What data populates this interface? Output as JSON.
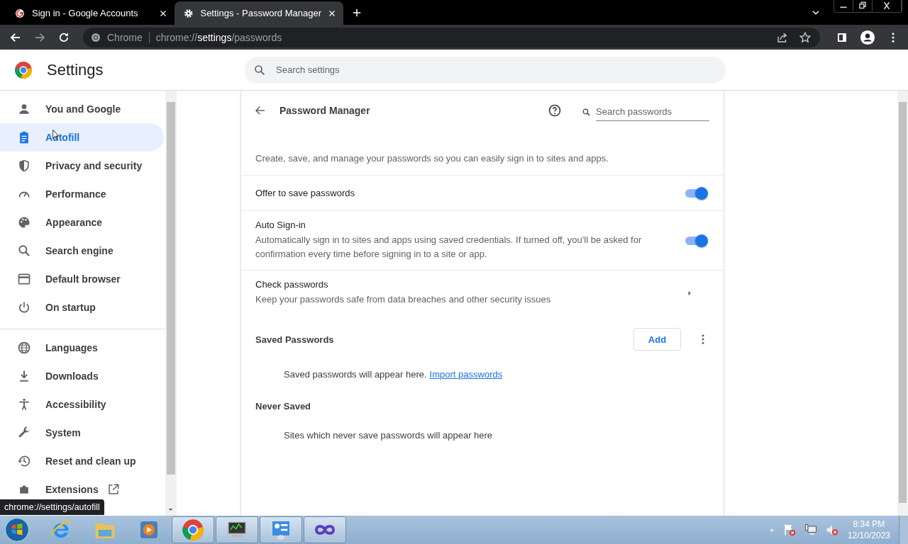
{
  "tabs": [
    {
      "title": "Sign in - Google Accounts",
      "selected": false
    },
    {
      "title": "Settings - Password Manager",
      "selected": true
    }
  ],
  "omnibox": {
    "site": "Chrome",
    "url": "chrome://**settings**/passwords"
  },
  "header": {
    "title": "Settings",
    "search_placeholder": "Search settings"
  },
  "sidebar": {
    "items": [
      {
        "label": "You and Google",
        "selected": false
      },
      {
        "label": "Autofill",
        "selected": true
      },
      {
        "label": "Privacy and security",
        "selected": false
      },
      {
        "label": "Performance",
        "selected": false
      },
      {
        "label": "Appearance",
        "selected": false
      },
      {
        "label": "Search engine",
        "selected": false
      },
      {
        "label": "Default browser",
        "selected": false
      },
      {
        "label": "On startup",
        "selected": false
      },
      {
        "kind": "divider"
      },
      {
        "label": "Languages",
        "selected": false
      },
      {
        "label": "Downloads",
        "selected": false
      },
      {
        "label": "Accessibility",
        "selected": false
      },
      {
        "label": "System",
        "selected": false
      },
      {
        "label": "Reset and clean up",
        "selected": false
      },
      {
        "label": "Extensions",
        "selected": false
      }
    ]
  },
  "status_tooltip": "chrome://settings/autofill",
  "page": {
    "title": "Password Manager",
    "search_placeholder": "Search passwords",
    "intro": "Create, save, and manage your passwords so you can easily sign in to sites and apps.",
    "rows": [
      {
        "kind": "toggle",
        "title": "Offer to save passwords",
        "on": true
      },
      {
        "kind": "toggle",
        "title": "Auto Sign-in",
        "description": "Automatically sign in to sites and apps using saved credentials. If turned off, you'll be asked for confirmation every time before signing in to a site or app.",
        "on": true
      },
      {
        "kind": "link",
        "title": "Check passwords",
        "description": "Keep your passwords safe from data breaches and other security issues"
      }
    ],
    "saved": {
      "title": "Saved Passwords",
      "add_button": "Add",
      "empty_text": "Saved passwords will appear here.",
      "import_link": "Import passwords"
    },
    "never_saved": {
      "title": "Never Saved",
      "empty_text": "Sites which never save passwords will appear here"
    }
  },
  "taskbar": {
    "items": [
      {
        "running": false
      },
      {
        "running": false
      },
      {
        "running": false
      },
      {
        "running": true
      },
      {
        "running": true
      },
      {
        "running": true
      },
      {
        "running": true
      }
    ],
    "time": "8:34 PM",
    "date": "12/10/2023"
  }
}
